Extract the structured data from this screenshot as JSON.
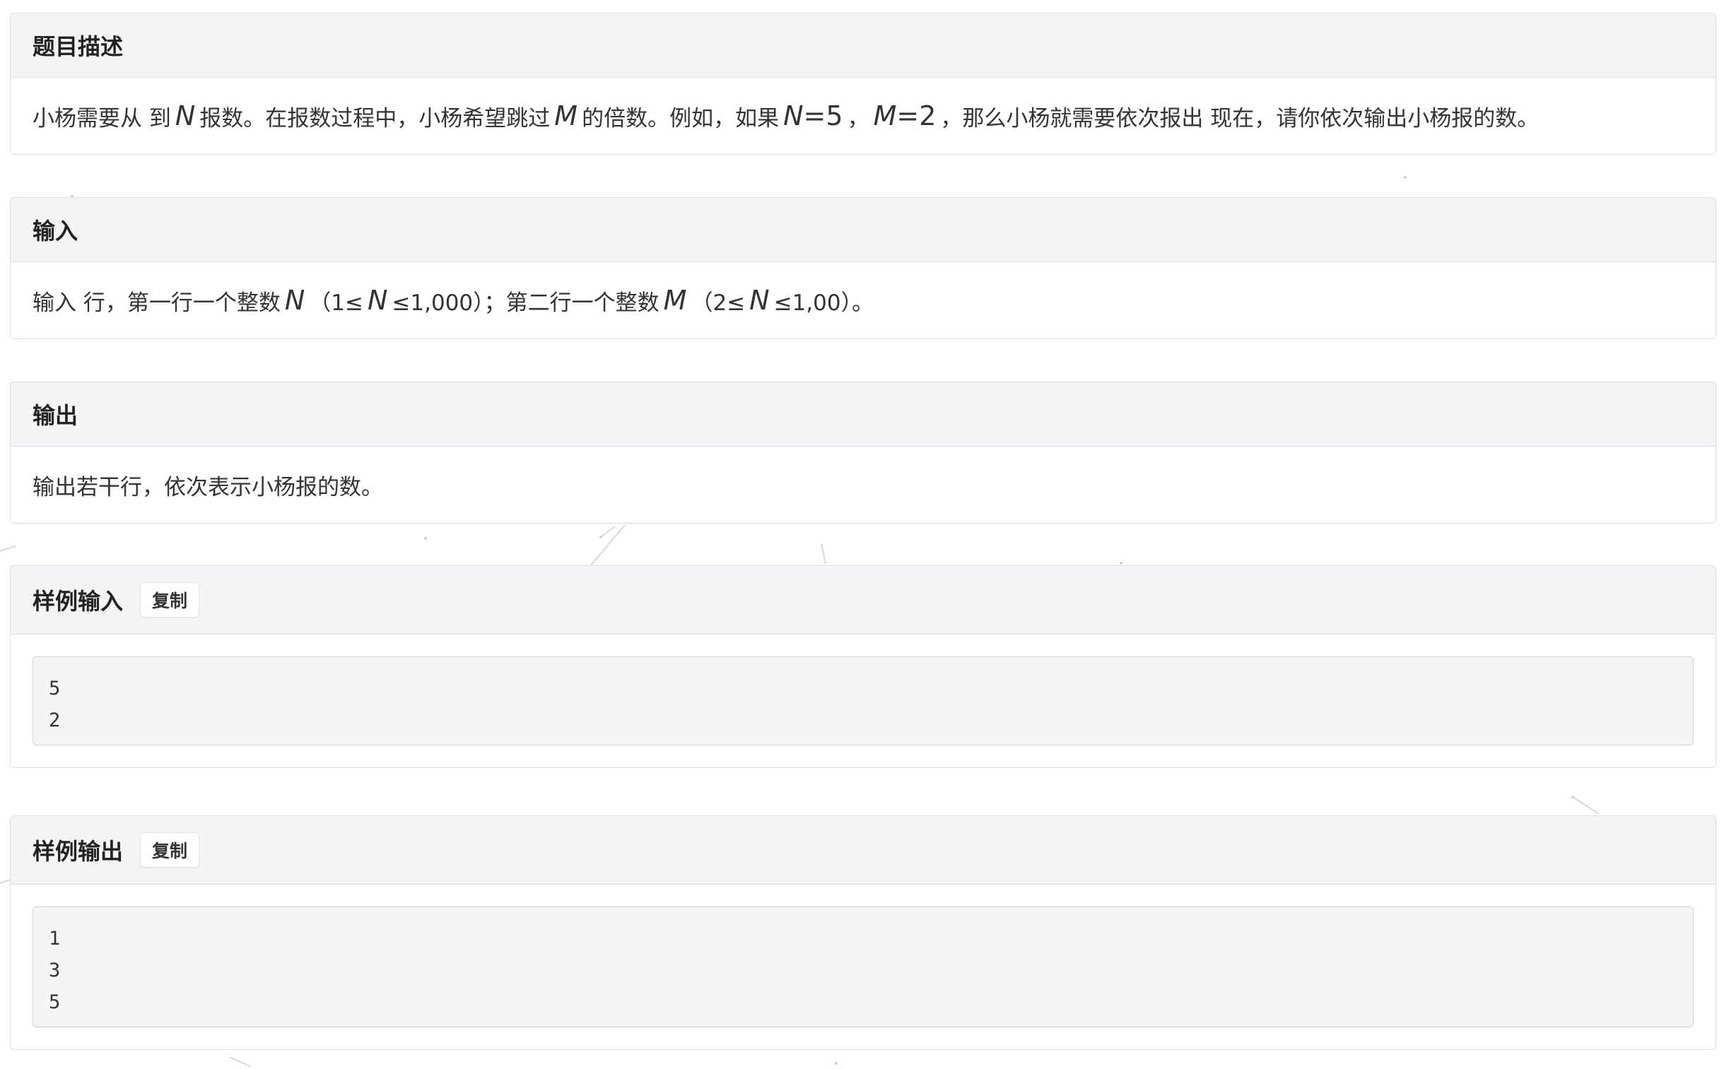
{
  "description": {
    "title": "题目描述",
    "segments": [
      {
        "t": "text",
        "v": "小杨需要从 到 "
      },
      {
        "t": "math",
        "v": "N"
      },
      {
        "t": "text",
        "v": "报数。在报数过程中，小杨希望跳过 "
      },
      {
        "t": "math",
        "v": "M"
      },
      {
        "t": "text",
        "v": "的倍数。例如，如果 "
      },
      {
        "t": "math",
        "v": "N=5"
      },
      {
        "t": "text",
        "v": "， "
      },
      {
        "t": "math",
        "v": "M=2"
      },
      {
        "t": "text",
        "v": "，那么小杨就需要依次报出 现在，请你依次输出小杨报的数。"
      }
    ]
  },
  "input": {
    "title": "输入",
    "segments": [
      {
        "t": "text",
        "v": "输入 行，第一行一个整数"
      },
      {
        "t": "math",
        "v": "N"
      },
      {
        "t": "text",
        "v": "（1≤"
      },
      {
        "t": "math",
        "v": "N"
      },
      {
        "t": "text",
        "v": "≤1,000）；第二行一个整数 "
      },
      {
        "t": "math",
        "v": "M"
      },
      {
        "t": "text",
        "v": "（2≤"
      },
      {
        "t": "math",
        "v": "N"
      },
      {
        "t": "text",
        "v": "≤1,00）。"
      }
    ]
  },
  "output": {
    "title": "输出",
    "text": "输出若干行，依次表示小杨报的数。"
  },
  "sample_input": {
    "title": "样例输入",
    "copy_label": "复制",
    "lines": [
      "5",
      "2"
    ]
  },
  "sample_output": {
    "title": "样例输出",
    "copy_label": "复制",
    "lines": [
      "1",
      "3",
      "5"
    ]
  }
}
